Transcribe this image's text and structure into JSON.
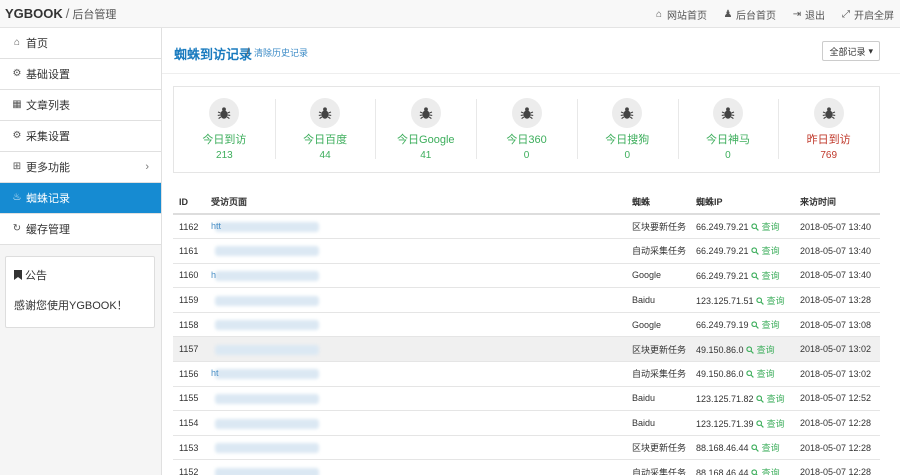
{
  "header": {
    "brand": "YGBOOK",
    "slash": "/",
    "subtitle": "后台管理",
    "nav": [
      {
        "icon": "⌂",
        "label": "网站首页"
      },
      {
        "icon": "♟",
        "label": "后台首页"
      },
      {
        "icon": "⇥",
        "label": "退出"
      },
      {
        "icon": "⤢",
        "label": "开启全屏"
      }
    ]
  },
  "sidebar": {
    "items": [
      {
        "icon": "⌂",
        "label": "首页"
      },
      {
        "icon": "⚙",
        "label": "基础设置"
      },
      {
        "icon": "▦",
        "label": "文章列表"
      },
      {
        "icon": "⚙",
        "label": "采集设置"
      },
      {
        "icon": "⊞",
        "label": "更多功能",
        "chevron": "›"
      },
      {
        "icon": "♨",
        "label": "蜘蛛记录"
      },
      {
        "icon": "↻",
        "label": "缓存管理"
      }
    ],
    "active_index": 5,
    "notice_title": "公告",
    "notice_body": "感谢您使用YGBOOK！"
  },
  "page": {
    "title": "蜘蛛到访记录",
    "sep": "/",
    "clear_link": "清除历史记录",
    "filter_label": "全部记录",
    "filter_caret": "▾"
  },
  "stats": [
    {
      "label": "今日到访",
      "value": "213",
      "color": "#3dae5c"
    },
    {
      "label": "今日百度",
      "value": "44",
      "color": "#3dae5c"
    },
    {
      "label": "今日Google",
      "value": "41",
      "color": "#3dae5c"
    },
    {
      "label": "今日360",
      "value": "0",
      "color": "#3dae5c"
    },
    {
      "label": "今日搜狗",
      "value": "0",
      "color": "#3dae5c"
    },
    {
      "label": "今日神马",
      "value": "0",
      "color": "#3dae5c"
    },
    {
      "label": "昨日到访",
      "value": "769",
      "color": "#c0392b"
    }
  ],
  "table": {
    "columns": [
      "ID",
      "受访页面",
      "蜘蛛",
      "蜘蛛IP",
      "来访时间"
    ],
    "query_label": "查询",
    "rows": [
      {
        "id": "1162",
        "page": "htt",
        "spider": "区块要新任务",
        "ip": "66.249.79.21",
        "time": "2018-05-07 13:40"
      },
      {
        "id": "1161",
        "page": "",
        "spider": "自动采集任务",
        "ip": "66.249.79.21",
        "time": "2018-05-07 13:40"
      },
      {
        "id": "1160",
        "page": "h",
        "spider": "Google",
        "ip": "66.249.79.21",
        "time": "2018-05-07 13:40"
      },
      {
        "id": "1159",
        "page": "",
        "spider": "Baidu",
        "ip": "123.125.71.51",
        "time": "2018-05-07 13:28"
      },
      {
        "id": "1158",
        "page": "",
        "spider": "Google",
        "ip": "66.249.79.19",
        "time": "2018-05-07 13:08"
      },
      {
        "id": "1157",
        "page": "",
        "spider": "区块更新任务",
        "ip": "49.150.86.0",
        "time": "2018-05-07 13:02"
      },
      {
        "id": "1156",
        "page": "ht",
        "spider": "自动采集任务",
        "ip": "49.150.86.0",
        "time": "2018-05-07 13:02"
      },
      {
        "id": "1155",
        "page": "",
        "spider": "Baidu",
        "ip": "123.125.71.82",
        "time": "2018-05-07 12:52"
      },
      {
        "id": "1154",
        "page": "",
        "spider": "Baidu",
        "ip": "123.125.71.39",
        "time": "2018-05-07 12:28"
      },
      {
        "id": "1153",
        "page": "",
        "spider": "区块更新任务",
        "ip": "88.168.46.44",
        "time": "2018-05-07 12:28"
      },
      {
        "id": "1152",
        "page": "",
        "spider": "自动采集任务",
        "ip": "88.168.46.44",
        "time": "2018-05-07 12:28"
      }
    ],
    "highlight_index": 5
  }
}
